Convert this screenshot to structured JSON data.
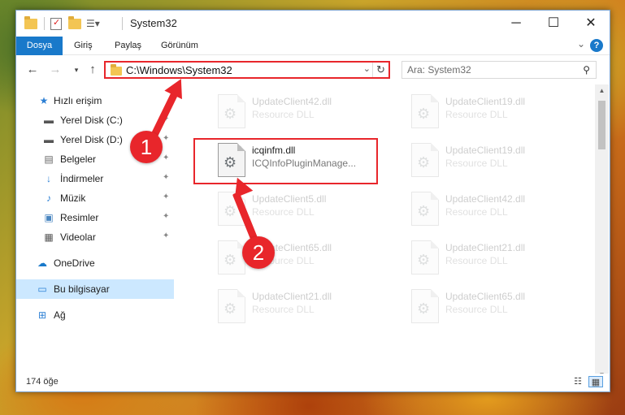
{
  "window": {
    "title": "System32"
  },
  "ribbon": {
    "tabs": [
      "Dosya",
      "Giriş",
      "Paylaş",
      "Görünüm"
    ]
  },
  "address": {
    "path": "C:\\Windows\\System32"
  },
  "search": {
    "placeholder": "Ara: System32"
  },
  "sidebar": {
    "items": [
      {
        "label": "Hızlı erişim",
        "icon": "star-icon"
      },
      {
        "label": "Yerel Disk (C:)",
        "icon": "drive-icon"
      },
      {
        "label": "Yerel Disk (D:)",
        "icon": "drive-icon"
      },
      {
        "label": "Belgeler",
        "icon": "documents-icon"
      },
      {
        "label": "İndirmeler",
        "icon": "download-icon"
      },
      {
        "label": "Müzik",
        "icon": "music-icon"
      },
      {
        "label": "Resimler",
        "icon": "pictures-icon"
      },
      {
        "label": "Videolar",
        "icon": "videos-icon"
      },
      {
        "label": "OneDrive",
        "icon": "cloud-icon"
      },
      {
        "label": "Bu bilgisayar",
        "icon": "computer-icon"
      },
      {
        "label": "Ağ",
        "icon": "network-icon"
      }
    ]
  },
  "files": [
    {
      "name": "UpdateClient42.dll",
      "desc": "Resource DLL"
    },
    {
      "name": "UpdateClient19.dll",
      "desc": "Resource DLL"
    },
    {
      "name": "icqinfm.dll",
      "desc": "ICQInfoPluginManage..."
    },
    {
      "name": "UpdateClient19.dll",
      "desc": "Resource DLL"
    },
    {
      "name": "UpdateClient5.dll",
      "desc": "Resource DLL"
    },
    {
      "name": "UpdateClient42.dll",
      "desc": "Resource DLL"
    },
    {
      "name": "UpdateClient65.dll",
      "desc": "Resource DLL"
    },
    {
      "name": "UpdateClient21.dll",
      "desc": "Resource DLL"
    },
    {
      "name": "UpdateClient21.dll",
      "desc": "Resource DLL"
    },
    {
      "name": "UpdateClient65.dll",
      "desc": "Resource DLL"
    }
  ],
  "status": {
    "count": "174 öğe"
  },
  "annotations": {
    "step1": "1",
    "step2": "2",
    "color": "#e8262b"
  }
}
